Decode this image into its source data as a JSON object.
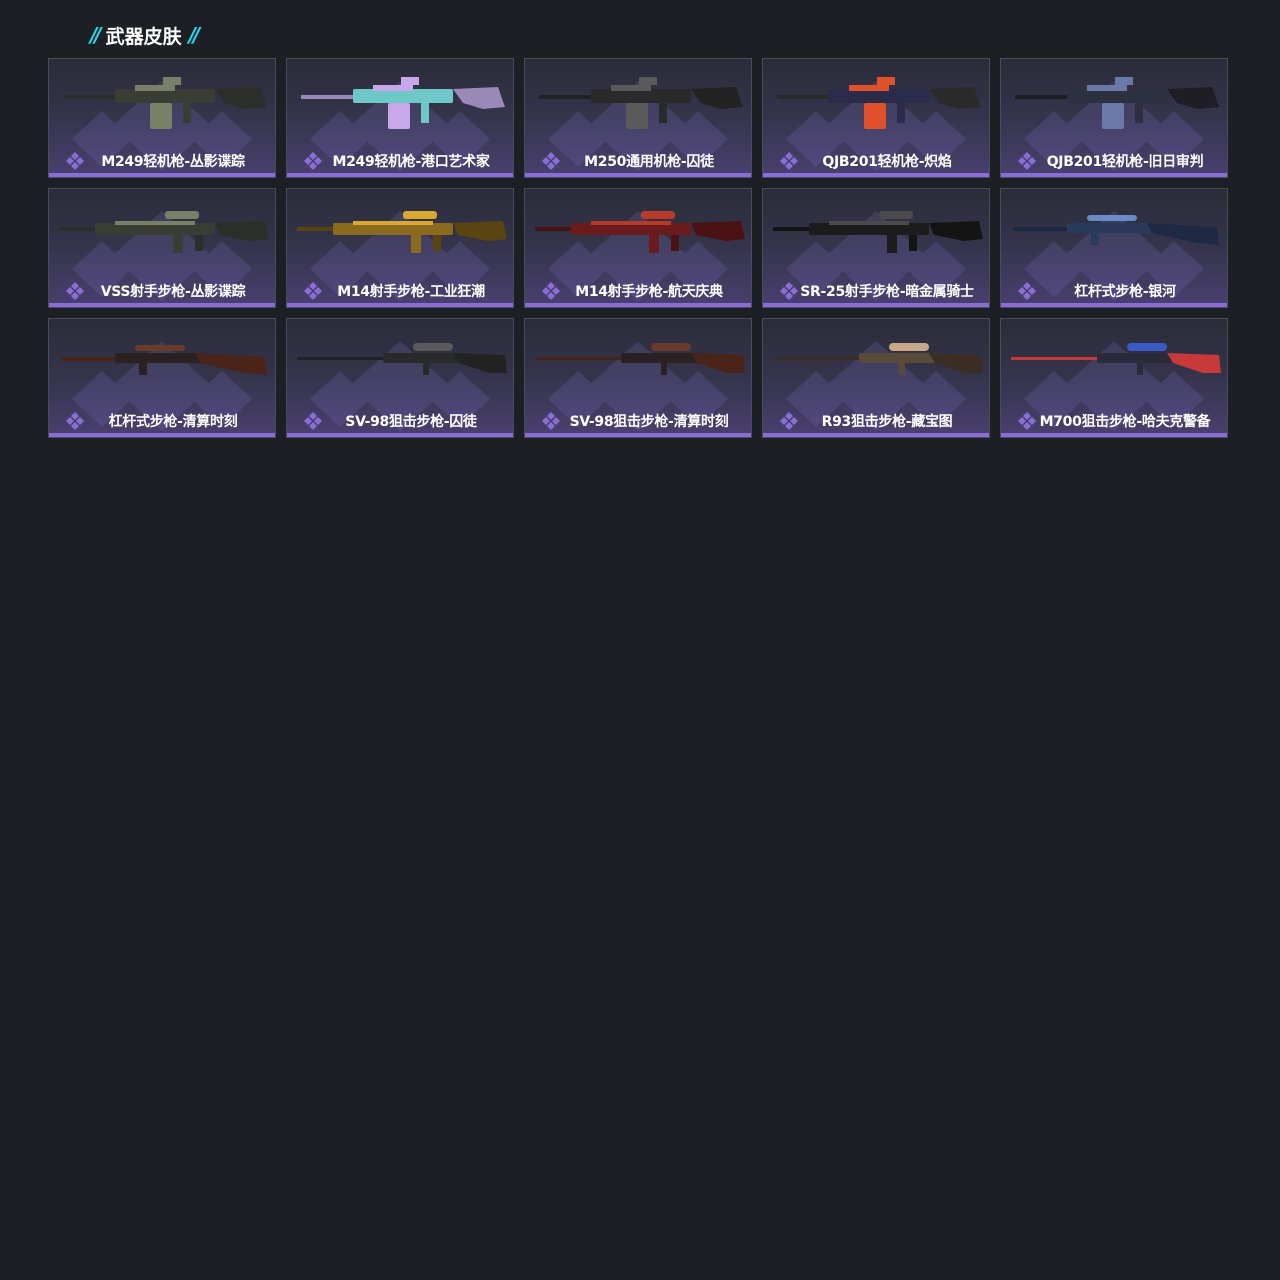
{
  "header": {
    "title": "武器皮肤"
  },
  "colors": {
    "background": "#1c2024",
    "accent": "#2ad4f0",
    "rarity": "#8a6ed8"
  },
  "items": [
    {
      "label": "M249轻机枪-丛影谍踪",
      "icon": "light-machine-gun-icon",
      "scheme": "camo"
    },
    {
      "label": "M249轻机枪-港口艺术家",
      "icon": "light-machine-gun-icon",
      "scheme": "pastel"
    },
    {
      "label": "M250通用机枪-囚徒",
      "icon": "machine-gun-icon",
      "scheme": "dark"
    },
    {
      "label": "QJB201轻机枪-炽焰",
      "icon": "light-machine-gun-icon",
      "scheme": "flame"
    },
    {
      "label": "QJB201轻机枪-旧日审判",
      "icon": "light-machine-gun-icon",
      "scheme": "steel"
    },
    {
      "label": "VSS射手步枪-丛影谍踪",
      "icon": "marksman-rifle-icon",
      "scheme": "camo"
    },
    {
      "label": "M14射手步枪-工业狂潮",
      "icon": "marksman-rifle-icon",
      "scheme": "gold"
    },
    {
      "label": "M14射手步枪-航天庆典",
      "icon": "marksman-rifle-icon",
      "scheme": "red"
    },
    {
      "label": "SR-25射手步枪-暗金属骑士",
      "icon": "marksman-rifle-icon",
      "scheme": "black"
    },
    {
      "label": "杠杆式步枪-银河",
      "icon": "lever-action-rifle-icon",
      "scheme": "blue"
    },
    {
      "label": "杠杆式步枪-清算时刻",
      "icon": "lever-action-rifle-icon",
      "scheme": "wood"
    },
    {
      "label": "SV-98狙击步枪-囚徒",
      "icon": "sniper-rifle-icon",
      "scheme": "dark"
    },
    {
      "label": "SV-98狙击步枪-清算时刻",
      "icon": "sniper-rifle-icon",
      "scheme": "wood"
    },
    {
      "label": "R93狙击步枪-藏宝图",
      "icon": "sniper-rifle-icon",
      "scheme": "map"
    },
    {
      "label": "M700狙击步枪-哈夫克警备",
      "icon": "sniper-rifle-icon",
      "scheme": "flag"
    }
  ]
}
